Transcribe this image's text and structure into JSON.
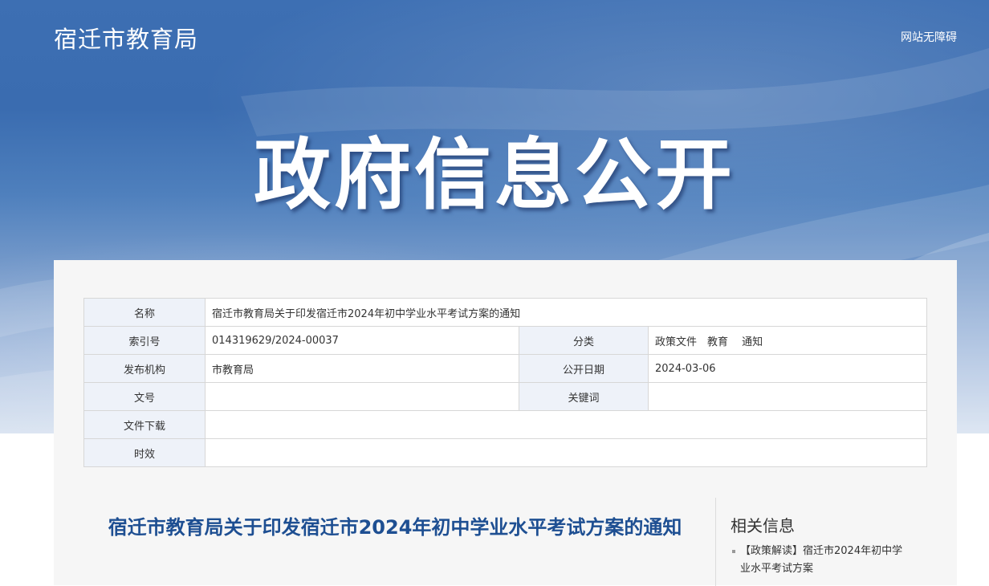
{
  "header": {
    "site_title": "宿迁市教育局",
    "accessibility_link": "网站无障碍",
    "banner_title": "政府信息公开"
  },
  "meta_table": {
    "name_label": "名称",
    "name_value": "宿迁市教育局关于印发宿迁市2024年初中学业水平考试方案的通知",
    "index_label": "索引号",
    "index_value": "014319629/2024-00037",
    "category_label": "分类",
    "category_value": "政策文件　教育　 通知",
    "publisher_label": "发布机构",
    "publisher_value": "市教育局",
    "date_label": "公开日期",
    "date_value": "2024-03-06",
    "doc_no_label": "文号",
    "doc_no_value": "",
    "keywords_label": "关键词",
    "keywords_value": "",
    "download_label": "文件下载",
    "download_value": "",
    "validity_label": "时效",
    "validity_value": ""
  },
  "article": {
    "title": "宿迁市教育局关于印发宿迁市2024年初中学业水平考试方案的通知"
  },
  "related": {
    "title": "相关信息",
    "items": [
      {
        "line1": "【政策解读】宿迁市2024年初中学",
        "line2": "业水平考试方案"
      }
    ]
  },
  "colors": {
    "banner_blue": "#3a6cb0",
    "title_blue": "#1e4f92",
    "label_bg": "#eef2f9"
  }
}
